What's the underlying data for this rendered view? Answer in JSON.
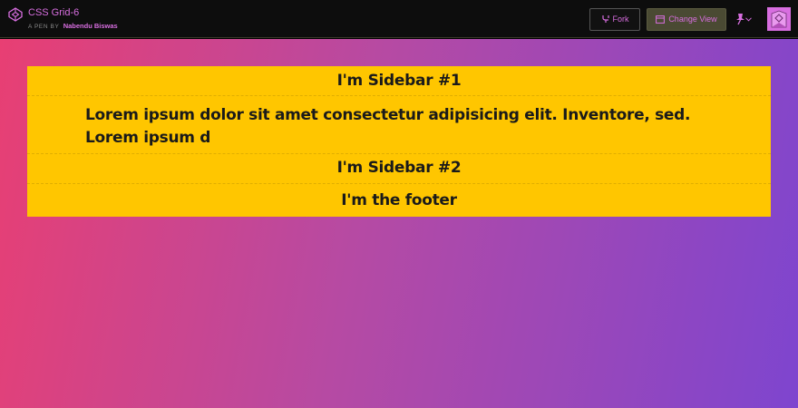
{
  "header": {
    "pen_title": "CSS Grid-6",
    "byline_prefix": "A PEN BY",
    "author": "Nabendu Biswas",
    "fork_label": "Fork",
    "change_view_label": "Change View"
  },
  "preview": {
    "sidebar1": "I'm Sidebar #1",
    "content": "Lorem ipsum dolor sit amet consectetur adipisicing elit. Inventore, sed. Lorem ipsum d",
    "sidebar2": "I'm Sidebar #2",
    "footer": "I'm the footer"
  },
  "colors": {
    "accent": "#d86ee0",
    "topbar_bg": "#0d0d0d",
    "grid_bg": "#ffc600",
    "gradient_start": "#e83f73",
    "gradient_end": "#7e45cf"
  },
  "icons": [
    "codepen-icon",
    "fork-icon",
    "change-view-icon",
    "pin-icon",
    "chevron-down-icon",
    "avatar"
  ]
}
